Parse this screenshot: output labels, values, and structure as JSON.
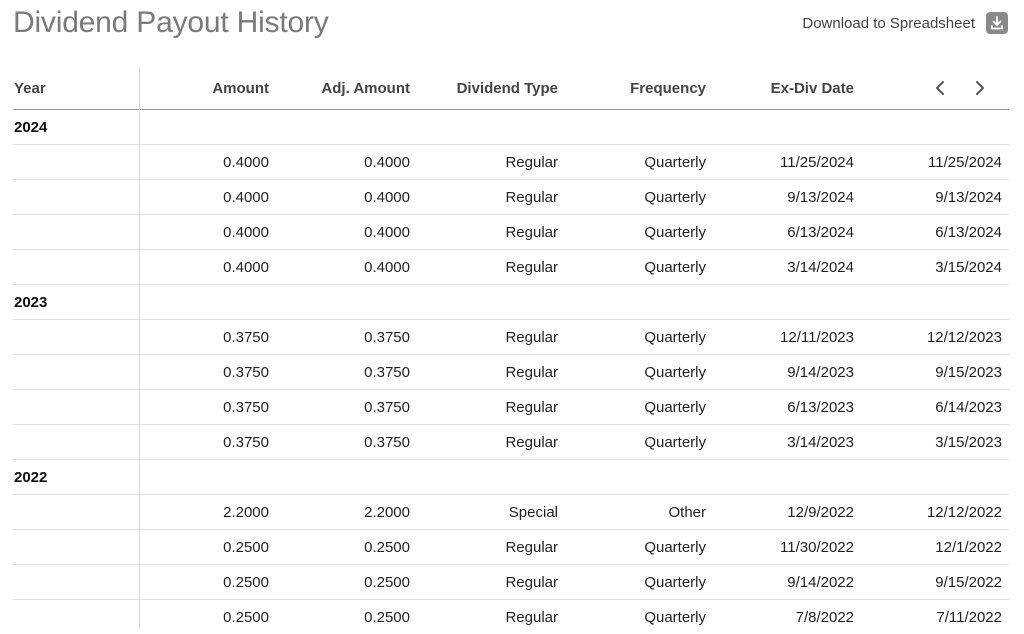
{
  "header": {
    "title": "Dividend Payout History",
    "download_label": "Download to Spreadsheet"
  },
  "columns": {
    "year": "Year",
    "amount": "Amount",
    "adj_amount": "Adj. Amount",
    "dividend_type": "Dividend Type",
    "frequency": "Frequency",
    "ex_div_date": "Ex-Div Date"
  },
  "groups": [
    {
      "year": "2024",
      "rows": [
        {
          "amount": "0.4000",
          "adj": "0.4000",
          "type": "Regular",
          "freq": "Quarterly",
          "exdiv": "11/25/2024",
          "next": "11/25/2024"
        },
        {
          "amount": "0.4000",
          "adj": "0.4000",
          "type": "Regular",
          "freq": "Quarterly",
          "exdiv": "9/13/2024",
          "next": "9/13/2024"
        },
        {
          "amount": "0.4000",
          "adj": "0.4000",
          "type": "Regular",
          "freq": "Quarterly",
          "exdiv": "6/13/2024",
          "next": "6/13/2024"
        },
        {
          "amount": "0.4000",
          "adj": "0.4000",
          "type": "Regular",
          "freq": "Quarterly",
          "exdiv": "3/14/2024",
          "next": "3/15/2024"
        }
      ]
    },
    {
      "year": "2023",
      "rows": [
        {
          "amount": "0.3750",
          "adj": "0.3750",
          "type": "Regular",
          "freq": "Quarterly",
          "exdiv": "12/11/2023",
          "next": "12/12/2023"
        },
        {
          "amount": "0.3750",
          "adj": "0.3750",
          "type": "Regular",
          "freq": "Quarterly",
          "exdiv": "9/14/2023",
          "next": "9/15/2023"
        },
        {
          "amount": "0.3750",
          "adj": "0.3750",
          "type": "Regular",
          "freq": "Quarterly",
          "exdiv": "6/13/2023",
          "next": "6/14/2023"
        },
        {
          "amount": "0.3750",
          "adj": "0.3750",
          "type": "Regular",
          "freq": "Quarterly",
          "exdiv": "3/14/2023",
          "next": "3/15/2023"
        }
      ]
    },
    {
      "year": "2022",
      "rows": [
        {
          "amount": "2.2000",
          "adj": "2.2000",
          "type": "Special",
          "freq": "Other",
          "exdiv": "12/9/2022",
          "next": "12/12/2022"
        },
        {
          "amount": "0.2500",
          "adj": "0.2500",
          "type": "Regular",
          "freq": "Quarterly",
          "exdiv": "11/30/2022",
          "next": "12/1/2022"
        },
        {
          "amount": "0.2500",
          "adj": "0.2500",
          "type": "Regular",
          "freq": "Quarterly",
          "exdiv": "9/14/2022",
          "next": "9/15/2022"
        },
        {
          "amount": "0.2500",
          "adj": "0.2500",
          "type": "Regular",
          "freq": "Quarterly",
          "exdiv": "7/8/2022",
          "next": "7/11/2022"
        }
      ]
    }
  ],
  "icons": {
    "download": "download-icon",
    "prev": "chevron-left-icon",
    "next": "chevron-right-icon"
  }
}
